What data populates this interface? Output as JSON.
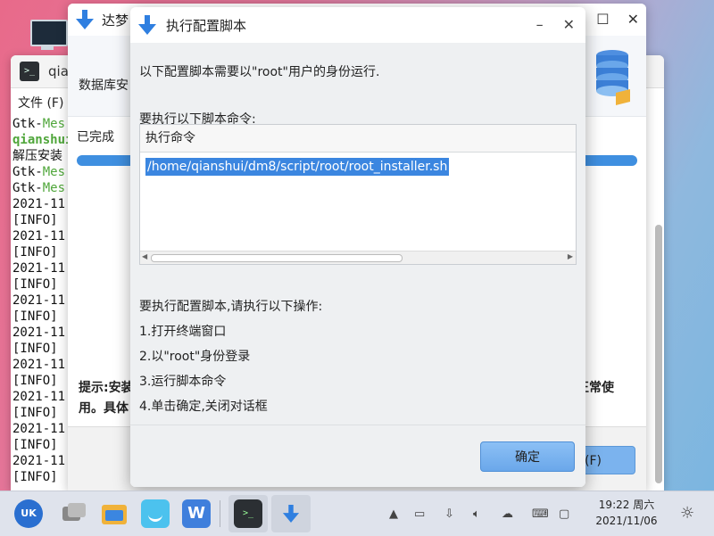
{
  "terminal": {
    "title": "qia",
    "menu_file": "文件 (F)",
    "lines": [
      {
        "a": "Gtk-",
        "b": "Mes"
      },
      {
        "a": "",
        "b": "qianshui"
      },
      {
        "a": "解压安装",
        "b": ""
      },
      {
        "a": "Gtk-",
        "b": "Mes"
      },
      {
        "a": "Gtk-",
        "b": "Mes"
      },
      {
        "a": "2021-11",
        "b": ""
      },
      {
        "a": "[INFO]",
        "b": ""
      },
      {
        "a": "2021-11",
        "b": ""
      },
      {
        "a": "[INFO]",
        "b": ""
      },
      {
        "a": "2021-11",
        "b": ""
      },
      {
        "a": "[INFO]",
        "b": ""
      },
      {
        "a": "2021-11",
        "b": ""
      },
      {
        "a": "[INFO]",
        "b": ""
      },
      {
        "a": "2021-11",
        "b": ""
      },
      {
        "a": "[INFO]",
        "b": ""
      },
      {
        "a": "2021-11",
        "b": ""
      },
      {
        "a": "[INFO]",
        "b": ""
      },
      {
        "a": "2021-11",
        "b": ""
      },
      {
        "a": "[INFO]",
        "b": ""
      },
      {
        "a": "2021-11",
        "b": ""
      },
      {
        "a": "[INFO]",
        "b": ""
      },
      {
        "a": "2021-11",
        "b": ""
      },
      {
        "a": "[INFO]",
        "b": ""
      }
    ]
  },
  "installer": {
    "title": "达梦",
    "db_label": "数据库安",
    "done_label": "已完成",
    "progress": 1.0,
    "tip_line1": "提示:安装",
    "tip_line2": "用。具体",
    "tip_right": "正常使",
    "finish_button": "成(F)"
  },
  "dialog": {
    "title": "执行配置脚本",
    "intro": "以下配置脚本需要以\"root\"用户的身份运行.",
    "cmd_label": "要执行以下脚本命令:",
    "table_header": "执行命令",
    "command": "/home/qianshui/dm8/script/root/root_installer.sh",
    "steps_title": "要执行配置脚本,请执行以下操作:",
    "steps": [
      "1.打开终端窗口",
      "2.以\"root\"身份登录",
      "3.运行脚本命令",
      "4.单击确定,关闭对话框"
    ],
    "ok_button": "确定"
  },
  "taskbar": {
    "time": "19:22 周六",
    "date": "2021/11/06"
  },
  "colors": {
    "accent": "#3b86e0",
    "progress": "#3f8fe0",
    "terminal_green": "#4fa63a"
  }
}
